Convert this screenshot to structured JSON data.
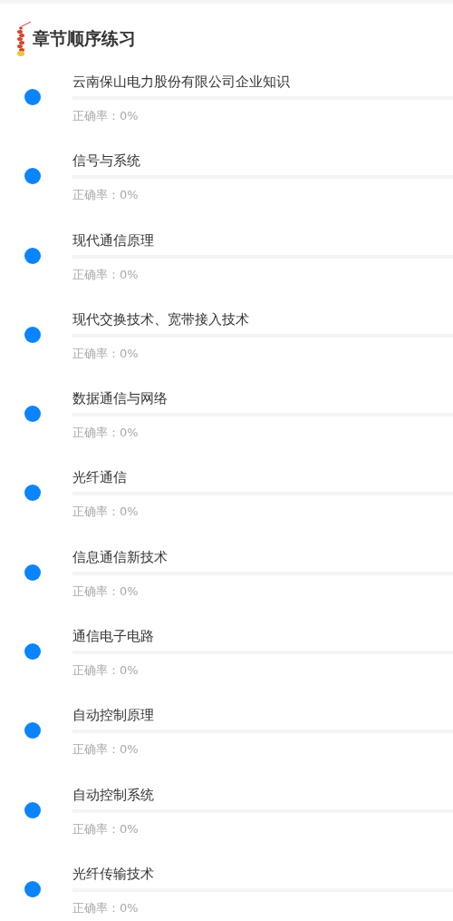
{
  "header": {
    "title": "章节顺序练习"
  },
  "chapters": [
    {
      "title": "云南保山电力股份有限公司企业知识",
      "level": 0,
      "accuracy": "正确率：0%"
    },
    {
      "title": "信号与系统",
      "level": 0,
      "accuracy": "正确率：0%"
    },
    {
      "title": "现代通信原理",
      "level": 0,
      "accuracy": "正确率：0%"
    },
    {
      "title": "现代交换技术、宽带接入技术",
      "level": 0,
      "accuracy": "正确率：0%"
    },
    {
      "title": "数据通信与网络",
      "level": 0,
      "accuracy": "正确率：0%"
    },
    {
      "title": "光纤通信",
      "level": 0,
      "accuracy": "正确率：0%"
    },
    {
      "title": "信息通信新技术",
      "level": 0,
      "accuracy": "正确率：0%"
    },
    {
      "title": "通信电子电路",
      "level": 0,
      "accuracy": "正确率：0%"
    },
    {
      "title": "自动控制原理",
      "level": 0,
      "accuracy": "正确率：0%"
    },
    {
      "title": "自动控制系统",
      "level": 0,
      "accuracy": "正确率：0%"
    },
    {
      "title": "光纤传输技术",
      "level": 0,
      "accuracy": "正确率：0%"
    }
  ]
}
